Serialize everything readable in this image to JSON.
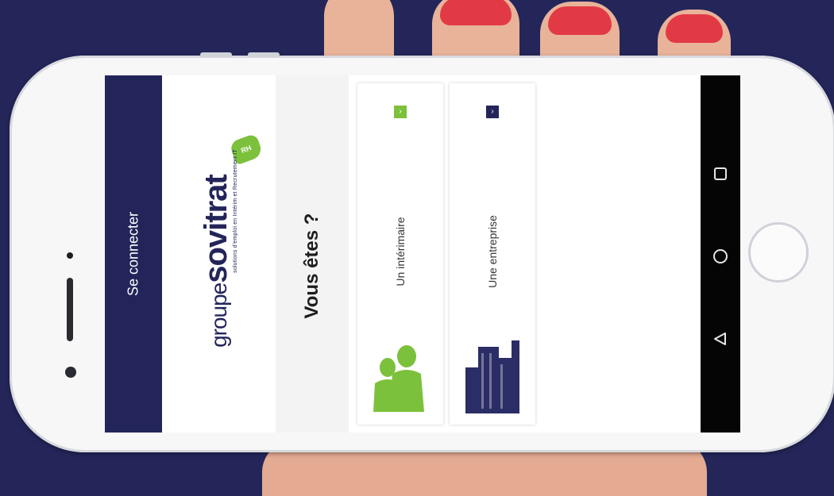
{
  "nav": {
    "title": "Se connecter"
  },
  "logo": {
    "prefix": "groupe",
    "name": "sovitrat",
    "tagline": "solutions d'emploi en Intérim et Recrutement IT",
    "badge": "RH"
  },
  "question": "Vous êtes ?",
  "choices": [
    {
      "label": "Un intérimaire",
      "accent": "#7cc13c",
      "icon": "people-icon"
    },
    {
      "label": "Une entreprise",
      "accent": "#23255a",
      "icon": "buildings-icon"
    }
  ],
  "colors": {
    "brand_navy": "#23255a",
    "brand_green": "#7cc13c",
    "background": "#24265a"
  },
  "system_nav": [
    "square-recents-icon",
    "circle-home-icon",
    "triangle-back-icon"
  ]
}
